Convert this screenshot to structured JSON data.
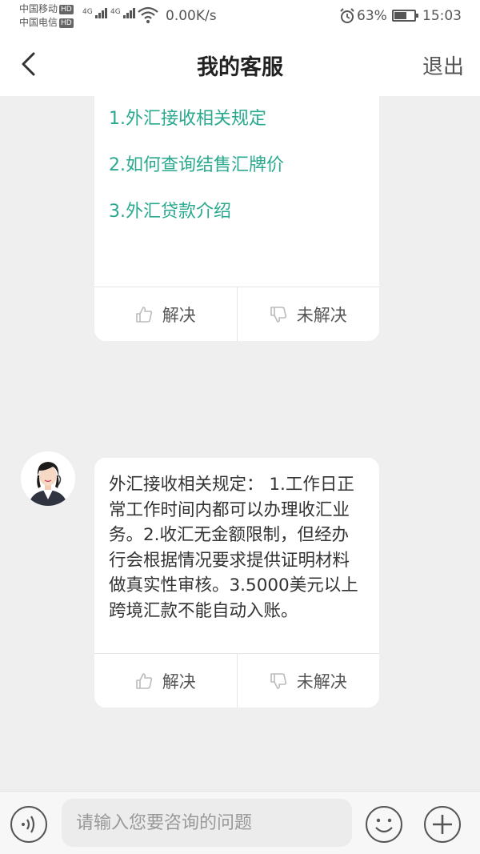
{
  "status_bar": {
    "carrier1": "中国移动",
    "carrier2": "中国电信",
    "hd_badge": "HD",
    "network1": "4G",
    "network2": "4G",
    "net_speed": "0.00K/s",
    "battery_percent": "63%",
    "battery_level": 0.63,
    "time": "15:03",
    "icons": [
      "signal-icon",
      "wifi-icon",
      "alarm-icon",
      "battery-icon"
    ]
  },
  "nav": {
    "title": "我的客服",
    "exit_label": "退出",
    "back_icon": "chevron-left-icon"
  },
  "chat": {
    "messages": [
      {
        "type": "link_list",
        "links": [
          "1.外汇接收相关规定",
          "2.如何查询结售汇牌价",
          "3.外汇贷款介绍"
        ],
        "feedback": {
          "solved": "解决",
          "unsolved": "未解决"
        }
      },
      {
        "type": "text",
        "avatar": "agent-avatar",
        "text": "外汇接收相关规定： 1.工作日正常工作时间内都可以办理收汇业务。2.收汇无金额限制，但经办行会根据情况要求提供证明材料做真实性审核。3.5000美元以上跨境汇款不能自动入账。",
        "feedback": {
          "solved": "解决",
          "unsolved": "未解决"
        }
      }
    ],
    "link_color": "#2aa98f"
  },
  "input_bar": {
    "placeholder": "请输入您要咨询的问题",
    "value": "",
    "icons": [
      "voice-icon",
      "emoji-icon",
      "plus-icon"
    ]
  }
}
